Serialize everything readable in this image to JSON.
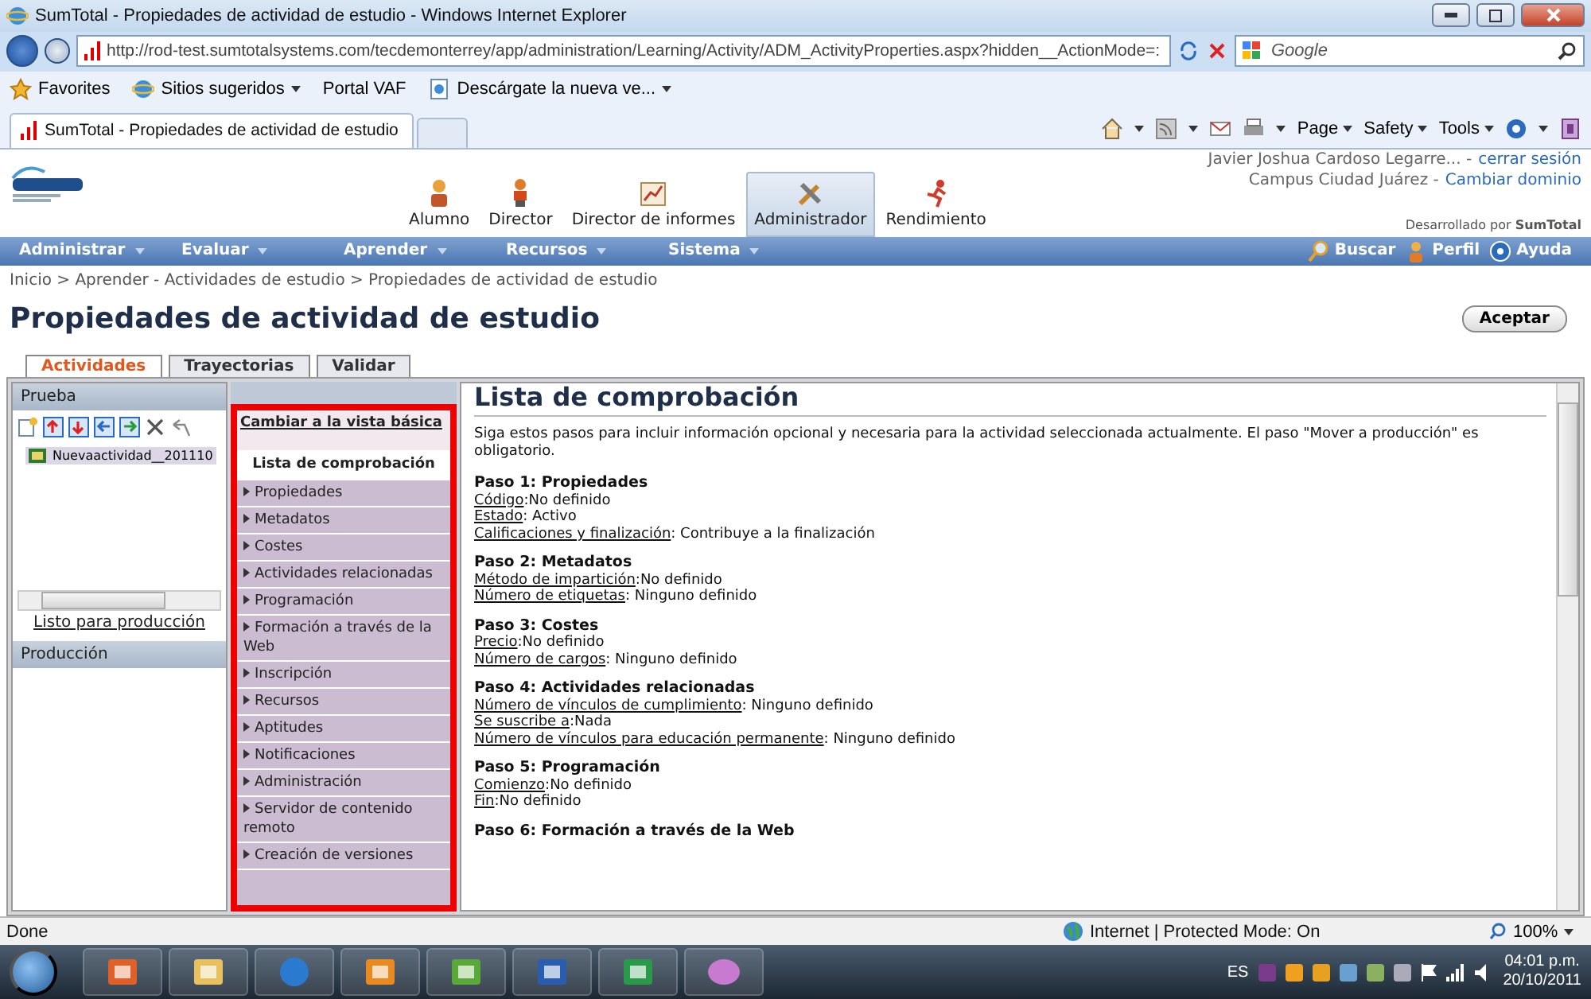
{
  "window": {
    "title": "SumTotal - Propiedades de actividad de estudio - Windows Internet Explorer"
  },
  "browser": {
    "address": "http://rod-test.sumtotalsystems.com/tecdemonterrey/app/administration/Learning/Activity/ADM_ActivityProperties.aspx?hidden__ActionMode=:",
    "search_placeholder": "Google",
    "favorites": [
      {
        "label": "Favorites",
        "kind": "star"
      },
      {
        "label": "Sitios sugeridos",
        "kind": "ie"
      },
      {
        "label": "Portal VAF",
        "kind": "plain"
      },
      {
        "label": "Descárgate la nueva ve...",
        "kind": "page"
      }
    ],
    "tab_title": "SumTotal - Propiedades de actividad de estudio",
    "commands": [
      "Page",
      "Safety",
      "Tools"
    ]
  },
  "header": {
    "roles": [
      {
        "label": "Alumno",
        "selected": false
      },
      {
        "label": "Director",
        "selected": false
      },
      {
        "label": "Director de informes",
        "selected": false
      },
      {
        "label": "Administrador",
        "selected": true
      },
      {
        "label": "Rendimiento",
        "selected": false
      }
    ],
    "user": "Javier Joshua Cardoso Legarre... -",
    "logout": "cerrar sesión",
    "campus": "Campus Ciudad Juárez -",
    "change_domain": "Cambiar dominio",
    "powered": "Desarrollado por **SumTotal**"
  },
  "nav": {
    "menus": [
      "Administrar",
      "Evaluar",
      "Aprender",
      "Recursos",
      "Sistema"
    ],
    "links": [
      "Buscar",
      "Perfil",
      "Ayuda"
    ]
  },
  "breadcrumb": "Inicio > Aprender - Actividades de estudio > Propiedades de actividad de estudio",
  "page_title": "Propiedades de actividad de estudio",
  "accept": "Aceptar",
  "tabs": [
    {
      "label": "Actividades",
      "selected": true
    },
    {
      "label": "Trayectorias",
      "selected": false
    },
    {
      "label": "Validar",
      "selected": false
    }
  ],
  "left": {
    "test_header": "Prueba",
    "tree_item": "Nuevaactividad__201110",
    "ready_link": "Listo para producción",
    "prod_header": "Producción"
  },
  "middle": {
    "basic_view": "Cambiar a la vista básica",
    "items": [
      {
        "label": "Lista de comprobación",
        "selected": true
      },
      {
        "label": "Propiedades",
        "selected": false
      },
      {
        "label": "Metadatos",
        "selected": false
      },
      {
        "label": "Costes",
        "selected": false
      },
      {
        "label": "Actividades relacionadas",
        "selected": false
      },
      {
        "label": "Programación",
        "selected": false
      },
      {
        "label": "Formación a través de la Web",
        "selected": false
      },
      {
        "label": "Inscripción",
        "selected": false
      },
      {
        "label": "Recursos",
        "selected": false
      },
      {
        "label": "Aptitudes",
        "selected": false
      },
      {
        "label": "Notificaciones",
        "selected": false
      },
      {
        "label": "Administración",
        "selected": false
      },
      {
        "label": "Servidor de contenido remoto",
        "selected": false
      },
      {
        "label": "Creación de versiones",
        "selected": false
      }
    ]
  },
  "content": {
    "heading": "Lista de comprobación",
    "intro": "Siga estos pasos para incluir información opcional y necesaria para la actividad seleccionada actualmente. El paso \"Mover a producción\" es obligatorio.",
    "steps": [
      {
        "title": "Paso 1: Propiedades",
        "fields": [
          {
            "label": "Código",
            "value": ":No definido"
          },
          {
            "label": "Estado",
            "value": ": Activo"
          },
          {
            "label": "Calificaciones y finalización",
            "value": ": Contribuye a la finalización"
          }
        ]
      },
      {
        "title": "Paso 2: Metadatos",
        "fields": [
          {
            "label": "Método de impartición",
            "value": ":No definido"
          },
          {
            "label": "Número de etiquetas",
            "value": ": Ninguno definido"
          }
        ]
      },
      {
        "title": "Paso 3: Costes",
        "fields": [
          {
            "label": "Precio",
            "value": ":No definido"
          },
          {
            "label": "Número de cargos",
            "value": ": Ninguno definido"
          }
        ]
      },
      {
        "title": "Paso 4: Actividades relacionadas",
        "fields": [
          {
            "label": "Número de vínculos de cumplimiento",
            "value": ": Ninguno definido"
          },
          {
            "label": "Se suscribe a",
            "value": ":Nada"
          },
          {
            "label": "Número de vínculos para educación permanente",
            "value": ": Ninguno definido"
          }
        ]
      },
      {
        "title": "Paso 5: Programación",
        "fields": [
          {
            "label": "Comienzo",
            "value": ":No definido"
          },
          {
            "label": "Fin",
            "value": ":No definido"
          }
        ]
      },
      {
        "title": "Paso 6: Formación a través de la Web"
      }
    ]
  },
  "status": {
    "text": "Done",
    "zone": "Internet | Protected Mode: On",
    "zoom": "100%"
  },
  "taskbar": {
    "language": "ES",
    "time": "04:01 p.m.",
    "date": "20/10/2011"
  }
}
